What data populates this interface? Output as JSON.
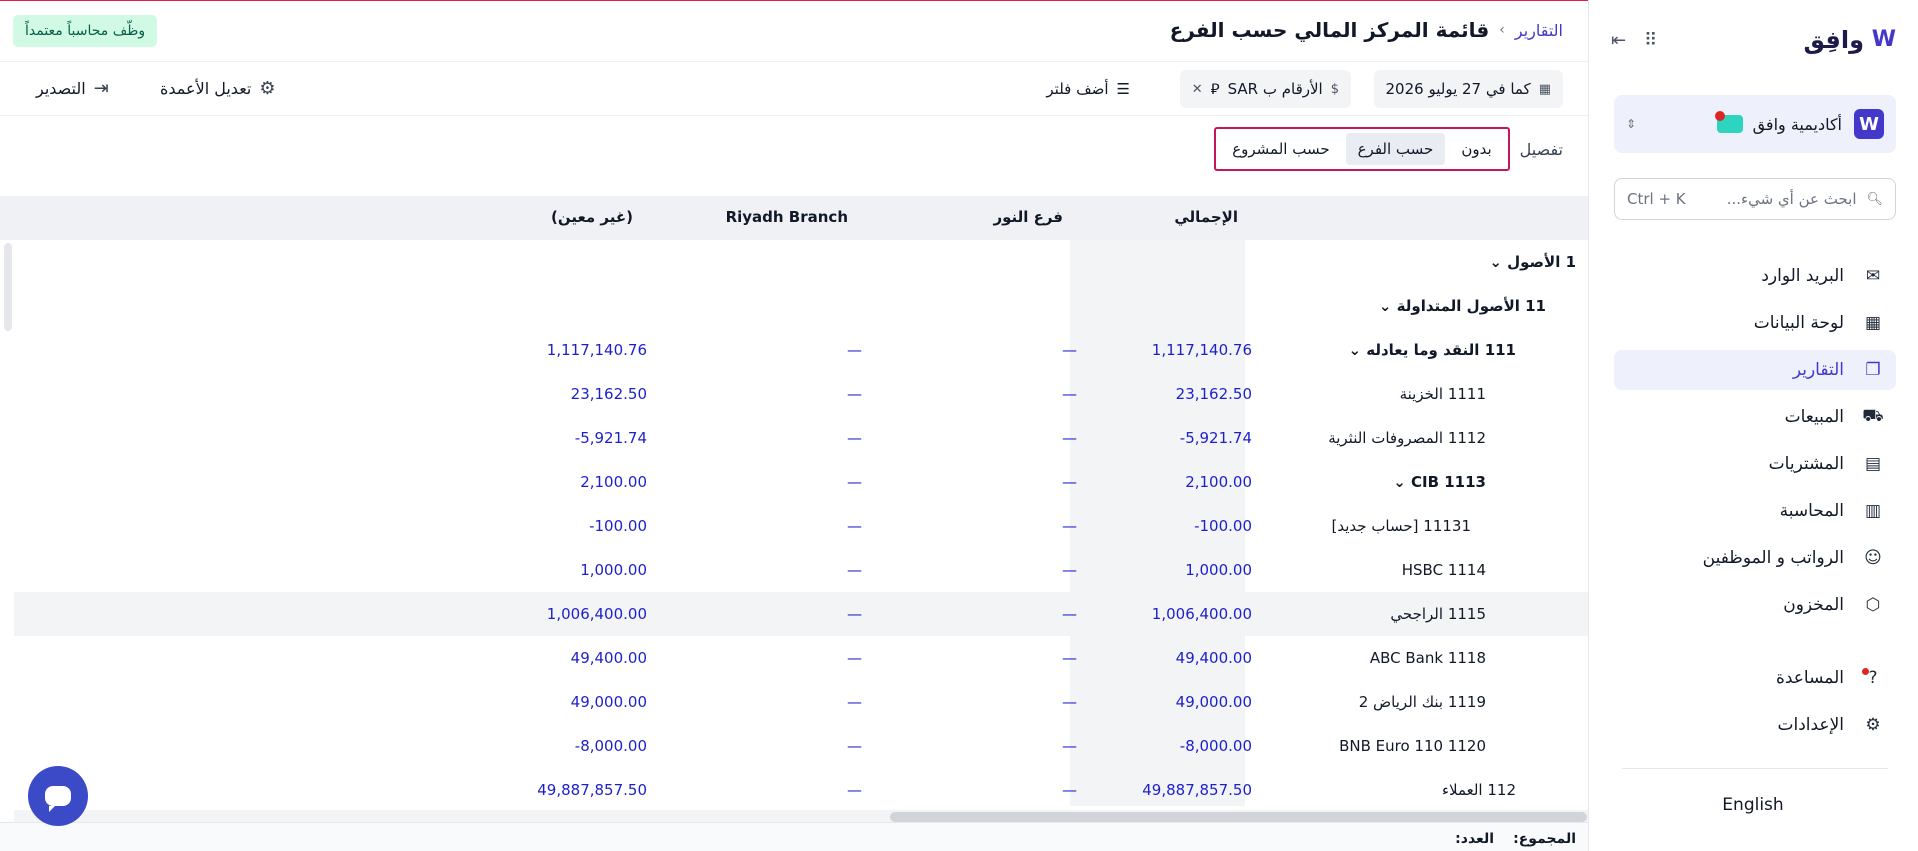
{
  "app": {
    "brand": "وافِق"
  },
  "sidebar": {
    "org_name": "أكاديمية وافق",
    "search_placeholder": "ابحث عن أي شيء...",
    "search_shortcut": "Ctrl + K",
    "items": [
      {
        "label": "البريد الوارد",
        "icon": "inbox-icon",
        "active": false
      },
      {
        "label": "لوحة البيانات",
        "icon": "dashboard-icon",
        "active": false
      },
      {
        "label": "التقارير",
        "icon": "reports-icon",
        "active": true
      },
      {
        "label": "المبيعات",
        "icon": "cart-icon",
        "active": false
      },
      {
        "label": "المشتريات",
        "icon": "receipt-icon",
        "active": false
      },
      {
        "label": "المحاسبة",
        "icon": "ledger-icon",
        "active": false
      },
      {
        "label": "الرواتب و الموظفين",
        "icon": "users-icon",
        "active": false
      },
      {
        "label": "المخزون",
        "icon": "box-icon",
        "active": false
      }
    ],
    "help_label": "المساعدة",
    "settings_label": "الإعدادات",
    "language": "English"
  },
  "header": {
    "breadcrumb_link": "التقارير",
    "breadcrumb_sep": "›",
    "title": "قائمة المركز المالي حسب الفرع",
    "hire_badge": "وظّف محاسباً معتمداً"
  },
  "toolbar": {
    "date_chip": "كما في 27 يوليو 2026",
    "currency_chip": "الأرقام ب SAR",
    "currency_symbol": "⃁",
    "add_filter": "أضف فلتر",
    "edit_columns": "تعديل الأعمدة",
    "export": "التصدير"
  },
  "detail": {
    "label": "تفصيل",
    "options": [
      "بدون",
      "حسب الفرع",
      "حسب المشروع"
    ],
    "selected": "حسب الفرع"
  },
  "table": {
    "columns": [
      "الإجمالي",
      "فرع النور",
      "Riyadh Branch",
      "(غير معين)"
    ],
    "rows": [
      {
        "account": "1 الأصول",
        "level": 0,
        "bold": true,
        "expand": true,
        "total": "",
        "alnoor": "",
        "riyadh": "",
        "unassigned": ""
      },
      {
        "account": "11 الأصول المتداولة",
        "level": 1,
        "bold": true,
        "expand": true,
        "total": "",
        "alnoor": "",
        "riyadh": "",
        "unassigned": ""
      },
      {
        "account": "111 النقد وما يعادله",
        "level": 2,
        "bold": true,
        "expand": true,
        "total": "1,117,140.76",
        "alnoor": "—",
        "riyadh": "—",
        "unassigned": "1,117,140.76"
      },
      {
        "account": "1111 الخزينة",
        "level": 3,
        "bold": false,
        "expand": false,
        "total": "23,162.50",
        "alnoor": "—",
        "riyadh": "—",
        "unassigned": "23,162.50"
      },
      {
        "account": "1112 المصروفات النثرية",
        "level": 3,
        "bold": false,
        "expand": false,
        "total": "-5,921.74",
        "alnoor": "—",
        "riyadh": "—",
        "unassigned": "-5,921.74"
      },
      {
        "account": "CIB 1113",
        "level": 3,
        "bold": true,
        "expand": true,
        "total": "2,100.00",
        "alnoor": "—",
        "riyadh": "—",
        "unassigned": "2,100.00"
      },
      {
        "account": "11131 [حساب جديد]",
        "level": 4,
        "bold": false,
        "expand": false,
        "total": "-100.00",
        "alnoor": "—",
        "riyadh": "—",
        "unassigned": "-100.00"
      },
      {
        "account": "HSBC 1114",
        "level": 3,
        "bold": false,
        "expand": false,
        "total": "1,000.00",
        "alnoor": "—",
        "riyadh": "—",
        "unassigned": "1,000.00"
      },
      {
        "account": "1115 الراجحي",
        "level": 3,
        "bold": false,
        "expand": false,
        "total": "1,006,400.00",
        "alnoor": "—",
        "riyadh": "—",
        "unassigned": "1,006,400.00",
        "highlight": true
      },
      {
        "account": "ABC Bank 1118",
        "level": 3,
        "bold": false,
        "expand": false,
        "total": "49,400.00",
        "alnoor": "—",
        "riyadh": "—",
        "unassigned": "49,400.00"
      },
      {
        "account": "1119 بنك الرياض 2",
        "level": 3,
        "bold": false,
        "expand": false,
        "total": "49,000.00",
        "alnoor": "—",
        "riyadh": "—",
        "unassigned": "49,000.00"
      },
      {
        "account": "BNB Euro 110 1120",
        "level": 3,
        "bold": false,
        "expand": false,
        "total": "-8,000.00",
        "alnoor": "—",
        "riyadh": "—",
        "unassigned": "-8,000.00"
      },
      {
        "account": "112 العملاء",
        "level": 2,
        "bold": false,
        "expand": false,
        "total": "49,887,857.50",
        "alnoor": "—",
        "riyadh": "—",
        "unassigned": "49,887,857.50"
      }
    ]
  },
  "footer": {
    "sum_label": "المجموع:",
    "count_label": "العدد:"
  },
  "colors": {
    "accent": "#4338ca",
    "number": "#1d1fcc",
    "highlight_border": "#c2185b"
  }
}
